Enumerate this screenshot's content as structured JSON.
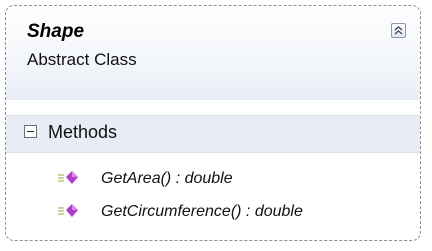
{
  "class": {
    "name": "Shape",
    "stereotype": "Abstract Class",
    "collapse_icon": "double-chevron-up-icon"
  },
  "sections": [
    {
      "label": "Methods",
      "toggle_icon": "collapse-minus-icon",
      "members": [
        {
          "signature": "GetArea() : double",
          "icon": "method-icon"
        },
        {
          "signature": "GetCircumference() : double",
          "icon": "method-icon"
        }
      ]
    }
  ],
  "colors": {
    "method_icon": "#b03cc8",
    "header_background": "#e8edf5",
    "border": "#8f8f8f"
  }
}
